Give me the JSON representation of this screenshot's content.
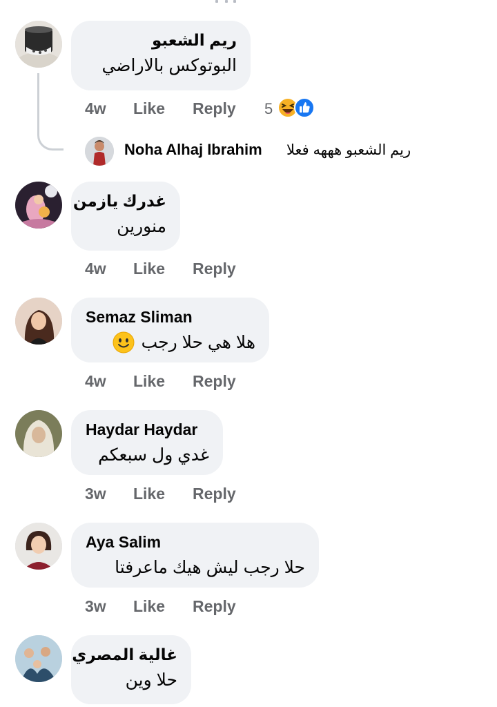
{
  "comments": [
    {
      "name": "ريم الشعبو",
      "text": "البوتوكس بالاراضي",
      "time": "4w",
      "like": "Like",
      "reply": "Reply",
      "reaction_count": "5",
      "reactions": [
        "haha-icon",
        "like-icon"
      ],
      "reply_preview": {
        "name": "Noha Alhaj Ibrahim",
        "text": "ريم الشعبو هههه فعلا"
      }
    },
    {
      "name": "غدرك يازمن",
      "text": "منورين",
      "time": "4w",
      "like": "Like",
      "reply": "Reply"
    },
    {
      "name": "Semaz Sliman",
      "text": "هلا هي حلا رجب",
      "emoji": "slightly-smiling-face-icon",
      "time": "4w",
      "like": "Like",
      "reply": "Reply"
    },
    {
      "name": "Haydar Haydar",
      "text": "غدي ول سبعكم",
      "time": "3w",
      "like": "Like",
      "reply": "Reply"
    },
    {
      "name": "Aya Salim",
      "text": "حلا رجب ليش هيك ماعرفتا",
      "time": "3w",
      "like": "Like",
      "reply": "Reply"
    },
    {
      "name": "غالية المصري",
      "text": "حلا وين"
    }
  ],
  "colors": {
    "bubble": "#f0f2f5",
    "meta": "#65676b",
    "like_blue": "#1877f2",
    "haha_yellow": "#f7b125",
    "thread_line": "#ccd0d5"
  }
}
